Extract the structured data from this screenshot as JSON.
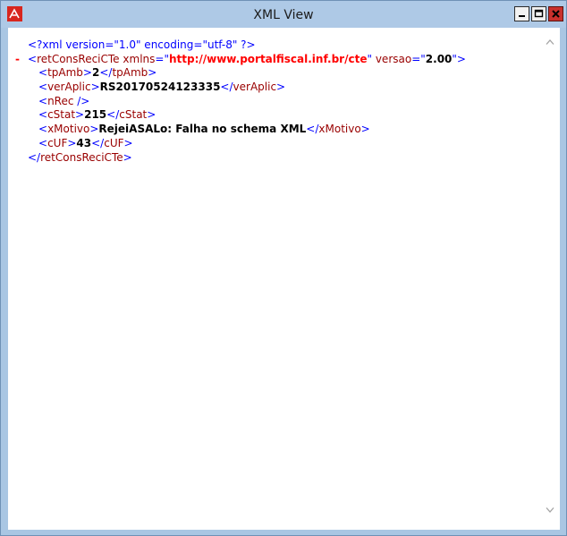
{
  "window": {
    "title": "XML View",
    "colors": {
      "frame": "#a9c6e3",
      "close": "#c9302c",
      "app_icon": "#d8261e"
    }
  },
  "xml": {
    "declaration": "<?xml version=\"1.0\" encoding=\"utf-8\" ?>",
    "collapse_glyph": "-",
    "root": {
      "name": "retConsReciCTe",
      "attrs": [
        {
          "name": "xmlns",
          "value": "http://www.portalfiscal.inf.br/cte"
        },
        {
          "name": "versao",
          "value": "2.00"
        }
      ],
      "children": [
        {
          "name": "tpAmb",
          "text": "2"
        },
        {
          "name": "verAplic",
          "text": "RS20170524123335"
        },
        {
          "name": "nRec"
        },
        {
          "name": "cStat",
          "text": "215"
        },
        {
          "name": "xMotivo",
          "text": "RejeiASALo: Falha no schema XML"
        },
        {
          "name": "cUF",
          "text": "43"
        }
      ]
    }
  },
  "icons": [
    "app-icon",
    "minimize-icon",
    "maximize-icon",
    "close-icon",
    "scroll-up-icon",
    "scroll-down-icon"
  ]
}
